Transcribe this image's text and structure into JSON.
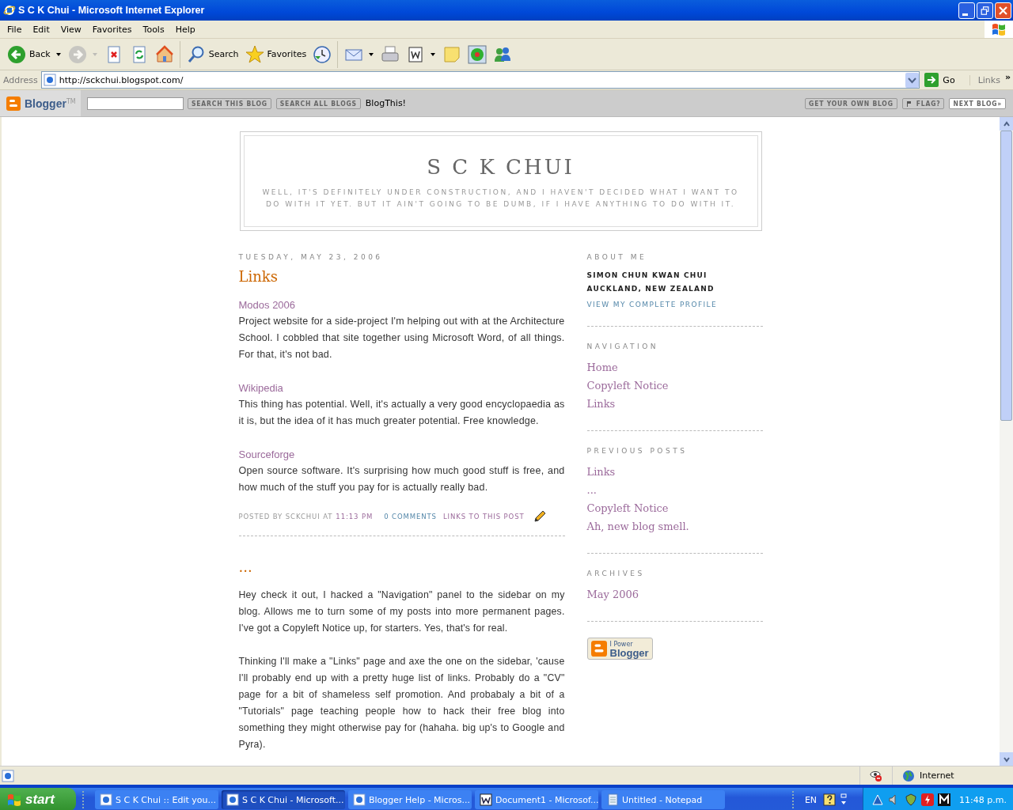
{
  "window": {
    "title": "S C K Chui - Microsoft Internet Explorer"
  },
  "menu": [
    "File",
    "Edit",
    "View",
    "Favorites",
    "Tools",
    "Help"
  ],
  "toolbar": [
    {
      "kind": "back",
      "label": "Back",
      "disabled": false,
      "dropdown": true
    },
    {
      "kind": "forward",
      "disabled": true,
      "dropdown": true
    },
    {
      "kind": "stop",
      "disabled": false,
      "dropdown": false
    },
    {
      "kind": "refresh",
      "disabled": false,
      "dropdown": false
    },
    {
      "kind": "home",
      "disabled": false,
      "dropdown": false
    },
    {
      "kind": "search",
      "label": "Search",
      "disabled": false,
      "dropdown": false
    },
    {
      "kind": "favorites",
      "label": "Favorites",
      "disabled": false,
      "dropdown": false
    },
    {
      "kind": "history",
      "disabled": false,
      "dropdown": false
    },
    {
      "kind": "mail",
      "disabled": false,
      "dropdown": true
    },
    {
      "kind": "print",
      "disabled": false,
      "dropdown": false
    },
    {
      "kind": "edit",
      "disabled": false,
      "dropdown": true
    },
    {
      "kind": "note",
      "disabled": false,
      "dropdown": false
    },
    {
      "kind": "flower",
      "disabled": false,
      "dropdown": false
    },
    {
      "kind": "messenger",
      "disabled": false,
      "dropdown": false
    }
  ],
  "address_bar": {
    "label": "Address",
    "url": "http://sckchui.blogspot.com/",
    "go": "Go",
    "links": "Links",
    "more": "»"
  },
  "blogger_bar": {
    "logo": "Blogger",
    "trademark": "TM",
    "search_buttons": [
      "SEARCH THIS BLOG",
      "SEARCH ALL BLOGS"
    ],
    "blog_this": "BlogThis!",
    "right_buttons": [
      {
        "kind": "plain",
        "label": "GET YOUR OWN BLOG"
      },
      {
        "kind": "flag",
        "label": "FLAG?"
      },
      {
        "kind": "next",
        "label": "NEXT BLOG»"
      }
    ]
  },
  "header": {
    "title": "S C K CHUI",
    "description": "WELL, IT'S DEFINITELY UNDER CONSTRUCTION, AND I HAVEN'T DECIDED WHAT I WANT TO DO WITH IT YET. BUT IT AIN'T GOING TO BE DUMB, IF I HAVE ANYTHING TO DO WITH IT."
  },
  "posts": [
    {
      "date": "TUESDAY, MAY 23, 2006",
      "title": "Links",
      "items": [
        {
          "link": "Modos 2006",
          "text": "Project website for a side-project I'm helping out with at the Architecture School. I cobbled that site together using Microsoft Word, of all things. For that, it's not bad."
        },
        {
          "link": "Wikipedia",
          "text": "This thing has potential. Well, it's actually a very good encyclopaedia as it is, but the idea of it has much greater potential. Free knowledge."
        },
        {
          "link": "Sourceforge",
          "text": "Open source software. It's surprising how much good stuff is free, and how much of the stuff you pay for is actually really bad."
        }
      ],
      "footer": {
        "posted_by": "POSTED BY SCKCHUI AT",
        "time": "11:13 PM",
        "comments": "0 COMMENTS",
        "backlinks": "LINKS TO THIS POST"
      }
    },
    {
      "title": "...",
      "paragraphs": [
        "Hey check it out, I hacked a \"Navigation\" panel to the sidebar on my blog. Allows me to turn some of my posts into more permanent pages. I've got a Copyleft Notice up, for starters. Yes, that's for real.",
        "Thinking I'll make a \"Links\" page and axe the one on the sidebar, 'cause I'll probably end up with a pretty huge list of links. Probably do a \"CV\" page for a bit of shameless self promotion. And probabaly a bit of a \"Tutorials\" page teaching people how to hack their free blog into something they might otherwise pay for (hahaha. big up's to Google and Pyra)."
      ]
    }
  ],
  "sidebar": {
    "about": {
      "heading": "ABOUT ME",
      "name": "SIMON CHUN KWAN CHUI",
      "location": "AUCKLAND, NEW ZEALAND",
      "profile_link": "VIEW MY COMPLETE PROFILE"
    },
    "sections": [
      {
        "heading": "NAVIGATION",
        "links": [
          "Home",
          "Copyleft Notice",
          "Links"
        ]
      },
      {
        "heading": "PREVIOUS POSTS",
        "links": [
          "Links",
          "...",
          "Copyleft Notice",
          "Ah, new blog smell."
        ]
      },
      {
        "heading": "ARCHIVES",
        "links": [
          "May 2006"
        ]
      }
    ],
    "badge": {
      "top": "I Power",
      "bottom": "Blogger"
    }
  },
  "status_bar": {
    "zone": "Internet"
  },
  "taskbar": {
    "start": "start",
    "tasks": [
      {
        "kind": "ie",
        "label": "S C K Chui :: Edit you...",
        "selected": false
      },
      {
        "kind": "ie",
        "label": "S C K Chui - Microsoft...",
        "selected": true
      },
      {
        "kind": "ie",
        "label": "Blogger Help - Micros...",
        "selected": false
      },
      {
        "kind": "word",
        "label": "Document1 - Microsof...",
        "selected": false
      },
      {
        "kind": "notepad",
        "label": "Untitled - Notepad",
        "selected": false
      }
    ],
    "language": "EN",
    "clock": "11:48 p.m."
  }
}
